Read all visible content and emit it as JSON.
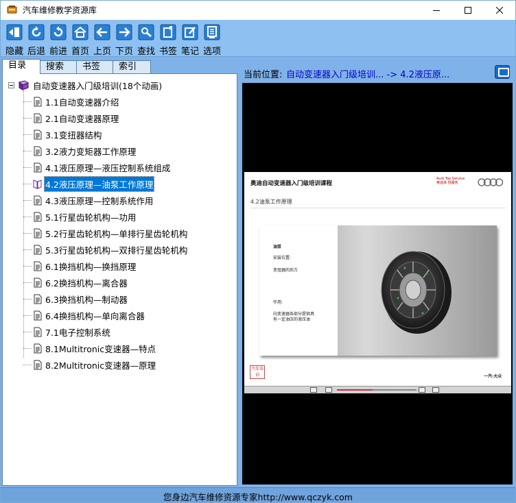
{
  "window": {
    "title": "汽车维修教学资源库"
  },
  "toolbar": {
    "items": [
      {
        "label": "隐藏",
        "icon": "hide-icon"
      },
      {
        "label": "后退",
        "icon": "back-icon"
      },
      {
        "label": "前进",
        "icon": "forward-icon"
      },
      {
        "label": "首页",
        "icon": "home-icon"
      },
      {
        "label": "上页",
        "icon": "prev-page-icon"
      },
      {
        "label": "下页",
        "icon": "next-page-icon"
      },
      {
        "label": "查找",
        "icon": "search-icon"
      },
      {
        "label": "书签",
        "icon": "bookmark-icon"
      },
      {
        "label": "笔记",
        "icon": "note-icon"
      },
      {
        "label": "选项",
        "icon": "options-icon"
      }
    ]
  },
  "tabs": [
    "目录",
    "搜索",
    "书签",
    "索引"
  ],
  "tree": {
    "root": "自动变速器入门级培训(18个动画)",
    "items": [
      "1.1自动变速器介绍",
      "2.1自动变速器原理",
      "3.1变扭器结构",
      "3.2液力变矩器工作原理",
      "4.1液压原理—液压控制系统组成",
      "4.2液压原理—油泵工作原理",
      "4.3液压原理—控制系统作用",
      "5.1行星齿轮机构—功用",
      "5.2行星齿轮机构—单排行星齿轮机构",
      "5.3行星齿轮机构—双排行星齿轮机构",
      "6.1换挡机构—换挡原理",
      "6.2换挡机构—离合器",
      "6.3换挡机构—制动器",
      "6.4换挡机构—单向离合器",
      "7.1电子控制系统",
      "8.1Multitronic变速器—特点",
      "8.2Multitronic变速器—原理"
    ],
    "selected_index": 5
  },
  "location": {
    "label": "当前位置:",
    "path": "自动变速器入门级培训... -> 4.2液压原..."
  },
  "slide": {
    "heading": "奥迪自动变速器入门级培训课程",
    "brand_line1": "Audi Top Service",
    "brand_line2": "奥迪卓·悦服务",
    "subheading": "4.2油泵工作原理",
    "card_title": "油泵",
    "position_label": "安装位置:",
    "position_value": "变扭器的后方",
    "function_label": "作用:",
    "function_line1": "向变速器各部分提供具",
    "function_line2": "有一定油压的液压油",
    "seal_text": "汽车培训",
    "footer": "一汽·大众"
  },
  "player": {
    "progress": 0.45
  },
  "status": {
    "text": "您身边汽车维修资源专家http://www.qczyk.com"
  },
  "colors": {
    "accent": "#0078d7",
    "toolbar": "#8ec1f1",
    "frame": "#7fb2e8"
  }
}
